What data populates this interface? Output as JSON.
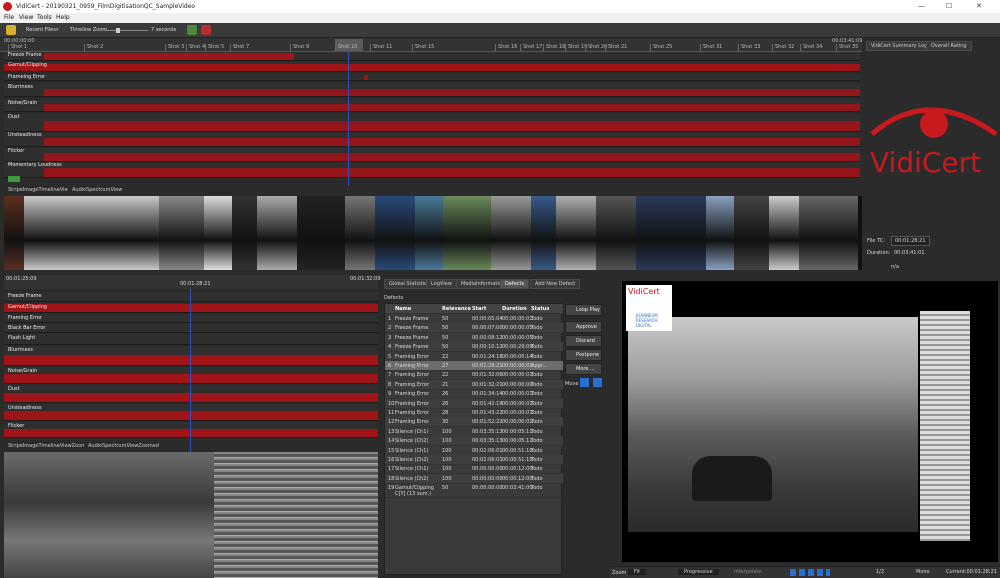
{
  "window": {
    "title": "VidiCert - 20190321_0959_FilmDigitisationQC_SampleVideo",
    "min": "—",
    "max": "☐",
    "close": "✕"
  },
  "menu": {
    "file": "File",
    "view": "View",
    "tools": "Tools",
    "help": "Help"
  },
  "toolbar": {
    "recent_files": "Recent Files",
    "timeline_zoom": "Timeline Zoom",
    "zoom_value": "7 seconds"
  },
  "ruler": {
    "start": "00:00:00:00",
    "end": "00:03:41:09",
    "shots": [
      "Shot 1",
      "Shot 2",
      "Shot 3",
      "Shot 4",
      "Shot 5",
      "Shot 7",
      "Shot 9",
      "Shot 10",
      "Shot 11",
      "Shot 15",
      "Shot 16",
      "Shot 17",
      "Shot 18",
      "Shot 19",
      "Shot 20",
      "Shot 21",
      "Shot 25",
      "Shot 31",
      "Shot 33",
      "Shot 32",
      "Shot 34",
      "Shot 35"
    ]
  },
  "tracks": [
    {
      "label": "Freeze Frame"
    },
    {
      "label": "Gamut/Clipping"
    },
    {
      "label": "Frameing Error"
    },
    {
      "label": "Blurriness"
    },
    {
      "label": "Noise/Grain"
    },
    {
      "label": "Dust"
    },
    {
      "label": "Unsteadiness"
    },
    {
      "label": "Flicker"
    },
    {
      "label": "Momentary Loudness"
    }
  ],
  "right_tabs": {
    "summary": "VidiCert Summary Logs",
    "rating": "Overall Rating"
  },
  "brand": {
    "name": "VidiCert",
    "accent": "#c8191f"
  },
  "view_tabs": {
    "stripe": "StripeImageTimelineView",
    "audio": "AudioSpectrumView"
  },
  "fileinfo": {
    "file_tc_label": "File TC:",
    "file_tc": "00:01:28:21",
    "duration_label": "Duration:",
    "duration": "00:03:41:01",
    "na": "n/a"
  },
  "zoom_ruler": {
    "start": "00:01:25:09",
    "cursor": "00:01:28:21",
    "end": "00:01:32:09"
  },
  "lower_tracks": [
    {
      "label": "Freeze Frame"
    },
    {
      "label": "Gamut/Clipping"
    },
    {
      "label": "Framing Error"
    },
    {
      "label": "Black Bar Error"
    },
    {
      "label": "Flash Light"
    },
    {
      "label": "Blurriness"
    },
    {
      "label": "Noise/Grain"
    },
    {
      "label": "Dust"
    },
    {
      "label": "Unsteadiness"
    },
    {
      "label": "Flicker"
    }
  ],
  "lower_tabs": {
    "stripe": "StripeImageTimelineViewZoomed",
    "audio": "AudioSpectrumViewZoomed"
  },
  "mid_tabs": [
    "Global Statistics",
    "LogView",
    "MediaInformation",
    "Defects",
    "Add New Defect"
  ],
  "defects": {
    "heading": "Defects",
    "columns": [
      "Name",
      "Relevance",
      "Start",
      "Duration",
      "Status"
    ],
    "rows": [
      [
        "1",
        "Freeze Frame",
        "50",
        "00:00:05:04",
        "00:00:00:01",
        "Todo"
      ],
      [
        "2",
        "Freeze Frame",
        "50",
        "00:00:07:00",
        "00:00:00:05",
        "Todo"
      ],
      [
        "3",
        "Freeze Frame",
        "50",
        "00:00:08:12",
        "00:00:00:05",
        "Todo"
      ],
      [
        "4",
        "Freeze Frame",
        "50",
        "00:00:10:12",
        "00:00:29:09",
        "Todo"
      ],
      [
        "5",
        "Framing Error",
        "22",
        "00:01:24:16",
        "00:00:00:14",
        "Todo"
      ],
      [
        "6",
        "Framing Error",
        "27",
        "00:01:28:21",
        "00:00:00:01",
        "Appr..."
      ],
      [
        "7",
        "Framing Error",
        "22",
        "00:01:32:06",
        "00:00:00:01",
        "Todo"
      ],
      [
        "8",
        "Framing Error",
        "21",
        "00:01:32:21",
        "00:00:00:00",
        "Todo"
      ],
      [
        "9",
        "Framing Error",
        "26",
        "00:01:34:14",
        "00:00:00:01",
        "Todo"
      ],
      [
        "10",
        "Framing Error",
        "26",
        "00:01:42:19",
        "00:00:00:01",
        "Todo"
      ],
      [
        "11",
        "Framing Error",
        "28",
        "00:01:43:22",
        "00:00:00:01",
        "Todo"
      ],
      [
        "12",
        "Framing Error",
        "30",
        "00:01:52:22",
        "00:00:00:01",
        "Todo"
      ],
      [
        "13",
        "Silence (Ch1)",
        "100",
        "00:03:35:13",
        "00:00:05:11",
        "Todo"
      ],
      [
        "14",
        "Silence (Ch2)",
        "100",
        "00:03:35:13",
        "00:00:05:11",
        "Todo"
      ],
      [
        "15",
        "Silence (Ch1)",
        "100",
        "00:02:06:01",
        "00:00:51:10",
        "Todo"
      ],
      [
        "16",
        "Silence (Ch2)",
        "100",
        "00:02:06:01",
        "00:00:51:10",
        "Todo"
      ],
      [
        "17",
        "Silence (Ch1)",
        "100",
        "00:00:00:00",
        "00:00:12:00",
        "Todo"
      ],
      [
        "18",
        "Silence (Ch2)",
        "100",
        "00:00:00:00",
        "00:00:12:00",
        "Todo"
      ],
      [
        "19",
        "Gamut/Clipping C[Y] (13 sum.)",
        "50",
        "00:00:00:00",
        "00:03:41:00",
        "Todo"
      ]
    ]
  },
  "buttons": {
    "loop": "Loop Play",
    "approve": "Approve",
    "discard": "Discard",
    "postpone": "Postpone",
    "more": "More ...",
    "move": "Move"
  },
  "viewer": {
    "logo": "VidiCert",
    "partner_line1": "JOANNEUM",
    "partner_line2": "RESEARCH",
    "partner_line3": "DIGITAL"
  },
  "status": {
    "zoom_label": "Zoom",
    "zoom_value": "Fit",
    "scan": "Progressive",
    "interp": "Interpolate",
    "ratio": "1/2",
    "mono": "Mono",
    "current": "Current:00:01:28:21"
  }
}
